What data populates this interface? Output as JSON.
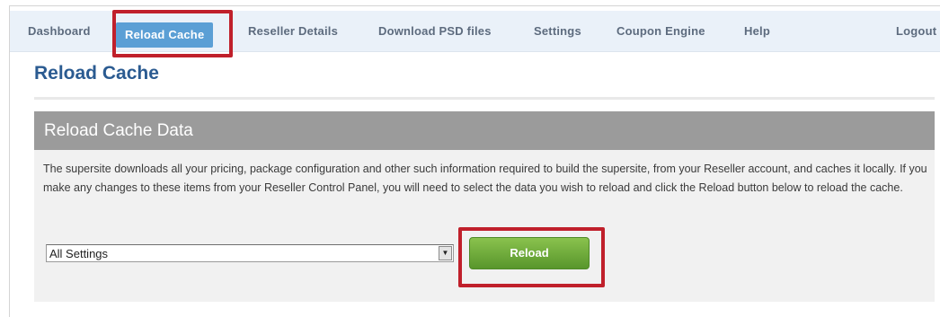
{
  "nav": {
    "items": [
      {
        "label": "Dashboard"
      },
      {
        "label": "Reload Cache"
      },
      {
        "label": "Reseller Details"
      },
      {
        "label": "Download PSD files"
      },
      {
        "label": "Settings"
      },
      {
        "label": "Coupon Engine"
      },
      {
        "label": "Help"
      },
      {
        "label": "Logout"
      }
    ],
    "active_index": 1
  },
  "page": {
    "title": "Reload Cache"
  },
  "panel": {
    "title": "Reload Cache Data",
    "description": "The supersite downloads all your pricing, package configuration and other such information required to build the supersite, from your Reseller account, and caches it locally. If you make any changes to these items from your Reseller Control Panel, you will need to select the data you wish to reload and click the Reload button below to reload the cache.",
    "select": {
      "selected": "All Settings"
    },
    "reload_label": "Reload"
  },
  "colors": {
    "nav_background": "#eaf1f9",
    "active_tab": "#5b9fd5",
    "title_blue": "#2b5b91",
    "panel_header": "#9b9b9b",
    "reload_button": "#6aaa38",
    "callout_red": "#c0202b"
  },
  "icons": {
    "select_arrow": "triangle-down-icon"
  }
}
